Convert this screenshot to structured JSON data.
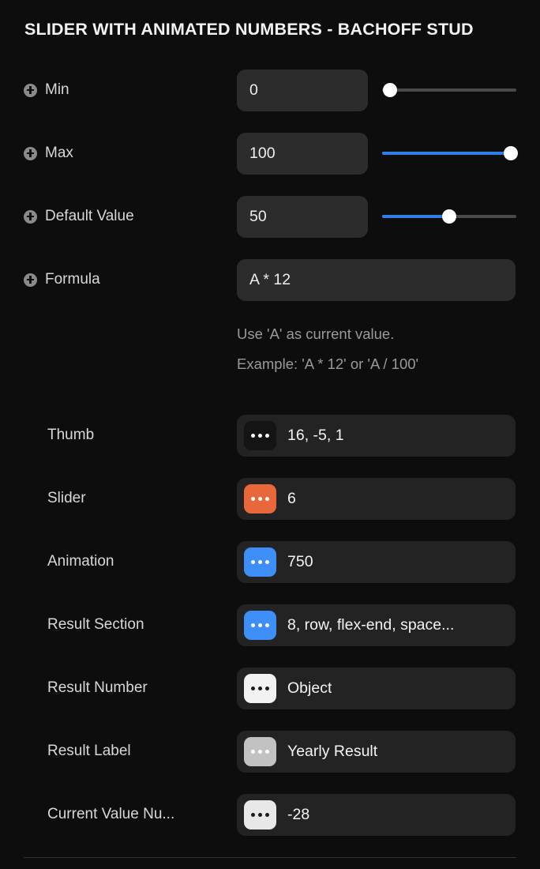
{
  "header": {
    "title": "SLIDER WITH ANIMATED NUMBERS - BACHOFF STUD"
  },
  "colors": {
    "background": "#0d0d0d",
    "field_background": "#2c2c2c",
    "pill_background": "#232323",
    "accent_blue": "#2f7fe8",
    "badge_blue": "#3d8ef7",
    "badge_orange": "#e8683c",
    "badge_dark": "#141414",
    "badge_grey": "#c2c2c2",
    "badge_light": "#e8e8e8",
    "label_text": "#d8d8d8",
    "hint_text": "#9a9a9a"
  },
  "properties": [
    {
      "label": "Min",
      "icon": "plus-circle-icon",
      "value": "0",
      "placeholder": "Min",
      "slider": {
        "percent": 0,
        "filled": false
      }
    },
    {
      "label": "Max",
      "icon": "plus-circle-icon",
      "value": "100",
      "placeholder": "Max",
      "slider": {
        "percent": 100,
        "filled": true
      }
    },
    {
      "label": "Default Value",
      "icon": "plus-circle-icon",
      "value": "50",
      "placeholder": "Default Value",
      "slider": {
        "percent": 50,
        "filled": true
      }
    }
  ],
  "formula": {
    "label": "Formula",
    "icon": "plus-circle-icon",
    "value": "A * 12",
    "placeholder": "Formula",
    "hint_line_1": "Use 'A' as current value.",
    "hint_line_2": "Example: 'A * 12' or 'A / 100'"
  },
  "style_rows": [
    {
      "label": "Thumb",
      "value": "16, -5, 1",
      "badge_color": "#141414",
      "dot_color": "light"
    },
    {
      "label": "Slider",
      "value": "6",
      "badge_color": "#e8683c",
      "dot_color": "light"
    },
    {
      "label": "Animation",
      "value": "750",
      "badge_color": "#3d8ef7",
      "dot_color": "light"
    },
    {
      "label": "Result Section",
      "value": "8, row, flex-end, space...",
      "badge_color": "#3d8ef7",
      "dot_color": "light"
    },
    {
      "label": "Result Number",
      "value": "Object",
      "badge_color": "#f2f2f2",
      "dot_color": "dark"
    },
    {
      "label": "Result Label",
      "value": "Yearly Result",
      "badge_color": "#c2c2c2",
      "dot_color": "light"
    },
    {
      "label": "Current Value Nu...",
      "value": "-28",
      "badge_color": "#e8e8e8",
      "dot_color": "dark"
    }
  ]
}
